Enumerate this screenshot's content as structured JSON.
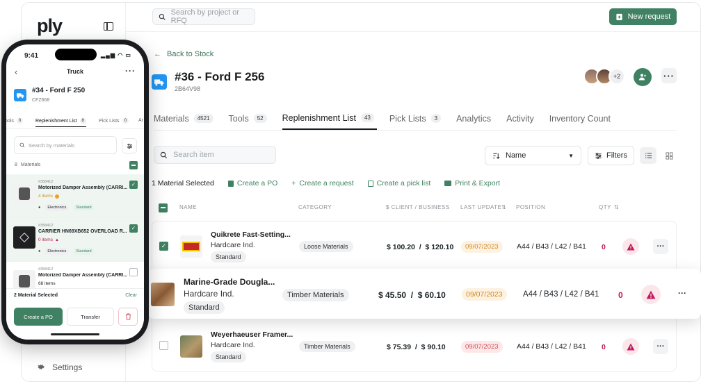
{
  "brand": {
    "logo": "ply",
    "accent": "#3f8162"
  },
  "topbar": {
    "search_placeholder": "Search by project or RFQ",
    "new_request_label": "New request"
  },
  "sidebar": {
    "settings_label": "Settings"
  },
  "header": {
    "back_label": "Back to Stock",
    "title": "#36 - Ford F 256",
    "code": "2B64V98",
    "avatars_more": "+2"
  },
  "tabs": [
    {
      "label": "Materials",
      "count": "4521"
    },
    {
      "label": "Tools",
      "count": "52"
    },
    {
      "label": "Replenishment List",
      "count": "43"
    },
    {
      "label": "Pick Lists",
      "count": "3"
    },
    {
      "label": "Analytics",
      "count": ""
    },
    {
      "label": "Activity",
      "count": ""
    },
    {
      "label": "Inventory Count",
      "count": ""
    }
  ],
  "toolbar": {
    "search_placeholder": "Search item",
    "sort_value": "Name",
    "filters_label": "Filters"
  },
  "actions": {
    "selected_text": "1 Material Selected",
    "create_po": "Create a PO",
    "create_request": "Create a request",
    "create_pick_list": "Create a pick list",
    "print_export": "Print & Export"
  },
  "table": {
    "headers": {
      "name": "NAME",
      "category": "CATEGORY",
      "price": "$ CLIENT / BUSINESS",
      "last_update": "LAST UPDATE",
      "position": "POSITION",
      "qty": "QTY"
    },
    "rows": [
      {
        "name": "Quikrete Fast-Setting...",
        "vendor": "Hardcare Ind.",
        "grade": "Standard",
        "category": "Loose Materials",
        "price": "$ 100.20  /  $ 120.10",
        "date": "09/07/2023",
        "position": "A44 / B43 / L42 / B41",
        "qty": "0",
        "checked": true
      },
      {
        "name": "Marine-Grade Dougla...",
        "vendor": "Hardcare Ind.",
        "grade": "Standard",
        "category": "Timber Materials",
        "price": "$ 45.50  /  $ 60.10",
        "date": "09/07/2023",
        "position": "A44 / B43 / L42 / B41",
        "qty": "0",
        "checked": false
      },
      {
        "name": "Weyerhaeuser Framer...",
        "vendor": "Hardcare Ind.",
        "grade": "Standard",
        "category": "Timber Materials",
        "price": "$ 75.39  /  $ 90.10",
        "date": "09/07/2023",
        "position": "A44 / B43 / L42 / B41",
        "qty": "0",
        "checked": false
      }
    ]
  },
  "phone": {
    "time": "9:41",
    "header_title": "Truck",
    "title": "#34 - Ford F 250",
    "code": "CFZ668",
    "tabs": [
      {
        "label": "ools",
        "count": "0"
      },
      {
        "label": "Replenishment List",
        "count": "8"
      },
      {
        "label": "Pick Lists",
        "count": "0"
      },
      {
        "label": "Ar",
        "count": ""
      }
    ],
    "search_placeholder": "Search by materials",
    "count_num": "8",
    "count_label": "Materials",
    "items": [
      {
        "code": "#358412",
        "name": "Motorized Damper Assembly (CARRI...",
        "stock": "4 items",
        "category": "Electronics",
        "grade": "Standard",
        "checked": true
      },
      {
        "code": "#358412",
        "name": "CARRIER HN69XB652 OVERLOAD R...",
        "stock": "0 items",
        "category": "Electronics",
        "grade": "Standard",
        "checked": true
      },
      {
        "code": "#358412",
        "name": "Motorized Damper Assembly (CARRI...",
        "stock": "68 items",
        "category": "",
        "grade": "",
        "checked": false
      }
    ],
    "selected_text": "2 Material Selected",
    "clear_label": "Clear",
    "create_po": "Create a PO",
    "transfer": "Transfer"
  }
}
